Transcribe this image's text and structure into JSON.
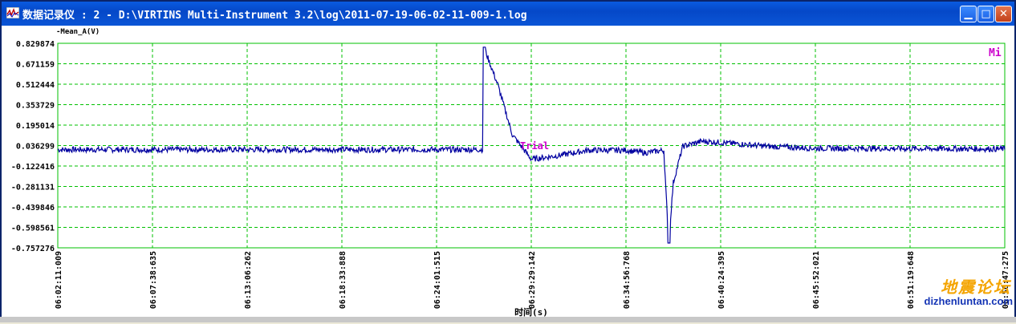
{
  "window": {
    "title": "数据记录仪 : 2 - D:\\VIRTINS Multi-Instrument 3.2\\log\\2011-07-19-06-02-11-009-1.log",
    "min_glyph": "▁",
    "max_glyph": "□",
    "close_glyph": "✕"
  },
  "colors": {
    "trace": "#0000A0",
    "grid": "#00C000",
    "marker": "#CC00CC",
    "titlebar": "#0548C8"
  },
  "chart_data": {
    "type": "line",
    "ylabel": "-Mean_A(V)",
    "xlabel": "时间(s)",
    "corner_label": "Mi",
    "annotation": "Trial",
    "y_ticks": [
      "0.829874",
      "0.671159",
      "0.512444",
      "0.353729",
      "0.195014",
      "0.036299",
      "-0.122416",
      "-0.281131",
      "-0.439846",
      "-0.598561",
      "-0.757276"
    ],
    "ylim": [
      -0.757276,
      0.829874
    ],
    "x_ticks": [
      "06:02:11:009",
      "06:07:38:635",
      "06:13:06:262",
      "06:18:33:888",
      "06:24:01:515",
      "06:29:29:142",
      "06:34:56:768",
      "06:40:24:395",
      "06:45:52:021",
      "06:51:19:648",
      "06:56:47:275"
    ],
    "grid": "on",
    "series": [
      {
        "x": [
          0,
          4.5,
          4.5,
          4.65,
          4.8,
          5.0,
          5.3,
          5.6,
          6.0,
          6.2,
          6.4,
          6.45,
          6.5,
          6.6,
          6.8,
          7.0,
          7.5,
          8.0,
          10.0
        ],
        "y": [
          0.005,
          0.005,
          0.8,
          0.5,
          0.12,
          -0.07,
          -0.04,
          0.0,
          0.0,
          -0.02,
          0.0,
          -0.72,
          -0.25,
          0.03,
          0.07,
          0.06,
          0.03,
          0.015,
          0.01
        ]
      }
    ]
  },
  "watermark": {
    "cn": "地震论坛",
    "en": "dizhenluntan.com"
  }
}
